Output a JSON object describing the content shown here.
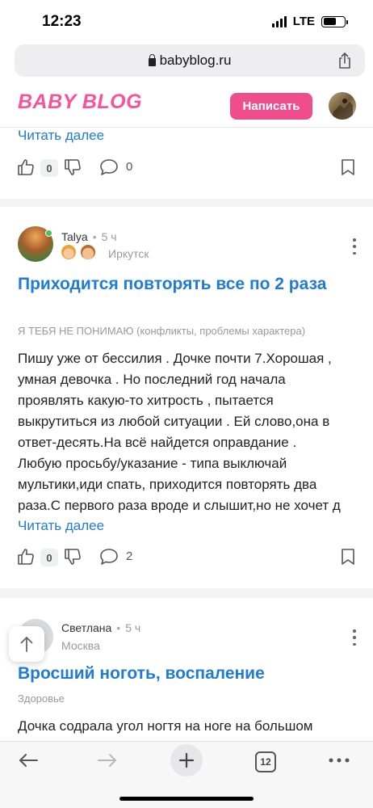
{
  "status": {
    "time": "12:23",
    "network": "LTE",
    "battery_level": 0.62
  },
  "browser": {
    "url": "babyblog.ru",
    "tab_count": "12"
  },
  "site": {
    "logo": "BABY BLOG",
    "write_button": "Написать"
  },
  "posts": [
    {
      "read_more": "Читать далее",
      "likes": "0",
      "comments": "0"
    },
    {
      "author": "Talya",
      "time": "5 ч",
      "location": "Иркутск",
      "title": "Приходится повторять все по 2 раза",
      "category": "Я ТЕБЯ НЕ ПОНИМАЮ (конфликты, проблемы характера)",
      "body": "Пишу уже от бессилия . Дочке почти 7.Хорошая ,\nумная девочка . Но последний год начала\nпроявлять какую-то хитрость , пытается\nвыкрутиться из любой ситуации . Ей слово,она в\nответ-десять.На всё найдется оправдание .\nЛюбую просьбу/указание - типа выключай\nмультики,иди спать, приходится повторять два\nраза.С первого раза вроде и слышит,но не хочет д",
      "read_more": "Читать далее",
      "likes": "0",
      "comments": "2"
    },
    {
      "author": "Светлана",
      "time": "5 ч",
      "location": "Москва",
      "title": "Вросший ноготь, воспаление",
      "category": "Здоровье",
      "body": "Дочка содрала угол ногтя на ноге на большом"
    }
  ],
  "icons": {
    "lock": "lock-icon",
    "share": "share-icon",
    "like": "thumbs-up-icon",
    "dislike": "thumbs-down-icon",
    "comment": "comment-icon",
    "bookmark": "bookmark-icon",
    "more": "kebab-icon",
    "scroll_up": "arrow-up-icon",
    "back": "arrow-left-icon",
    "forward": "arrow-right-icon",
    "new_tab": "plus-icon",
    "tabs": "tabs-icon",
    "menu": "more-dots-icon"
  },
  "colors": {
    "brand_pink": "#f7539c",
    "button_pink": "#ef4d8c",
    "link_blue": "#1f7bd6",
    "online": "#46c25d"
  }
}
